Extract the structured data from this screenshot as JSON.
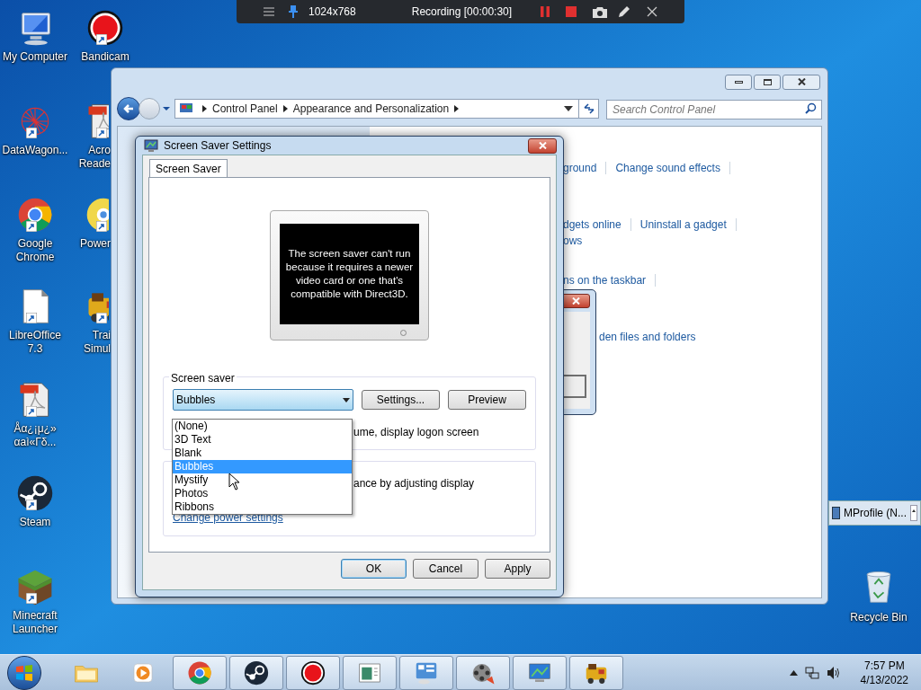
{
  "recorder_bar": {
    "resolution": "1024x768",
    "status": "Recording [00:00:30]"
  },
  "desktop_icons": [
    {
      "kind": "computer",
      "label_lines": [
        "My Computer"
      ]
    },
    {
      "kind": "recorder",
      "label_lines": [
        "Bandicam"
      ]
    },
    {
      "kind": "network",
      "label_lines": [
        "DataWagon..."
      ]
    },
    {
      "kind": "acrobat",
      "label_lines": [
        "Acro",
        "Reade"
      ]
    },
    {
      "kind": "chrome",
      "label_lines": [
        "Google",
        "Chrome"
      ]
    },
    {
      "kind": "disc",
      "label_lines": [
        "Power"
      ]
    },
    {
      "kind": "document",
      "label_lines": [
        "LibreOffice",
        "7.3"
      ]
    },
    {
      "kind": "train",
      "label_lines": [
        "Trai",
        "Simul"
      ]
    },
    {
      "kind": "pdf",
      "label_lines": [
        "Åα¿¡μ¿»",
        "αaì«Γδ..."
      ]
    },
    {
      "kind": "steam",
      "label_lines": [
        "Steam"
      ]
    },
    {
      "kind": "block",
      "label_lines": [
        "Minecraft",
        "Launcher"
      ]
    }
  ],
  "recycle_bin": {
    "label": "Recycle Bin"
  },
  "control_panel": {
    "breadcrumb": [
      "Control Panel",
      "Appearance and Personalization"
    ],
    "search": {
      "placeholder": "Search Control Panel"
    },
    "link_rows": [
      [
        "ground",
        "Change sound effects"
      ],
      [
        "dgets online",
        "Uninstall a gadget"
      ],
      [
        "ows"
      ],
      [
        "ns on the taskbar"
      ],
      [
        "den files and folders"
      ]
    ]
  },
  "dialog": {
    "title": "Screen Saver Settings",
    "tabs": [
      {
        "label": "Screen Saver",
        "selected": true
      }
    ],
    "preview_message": "The screen saver can't run because it requires a newer video card or one that's compatible with Direct3D.",
    "group_label": "Screen saver",
    "dropdown": {
      "value": "Bubbles",
      "expanded": true,
      "options": [
        {
          "label": "(None)",
          "selected": false
        },
        {
          "label": "3D Text",
          "selected": false
        },
        {
          "label": "Blank",
          "selected": false
        },
        {
          "label": "Bubbles",
          "selected": true
        },
        {
          "label": "Mystify",
          "selected": false
        },
        {
          "label": "Photos",
          "selected": false
        },
        {
          "label": "Ribbons",
          "selected": false
        }
      ]
    },
    "group_buttons": [
      "Settings...",
      "Preview"
    ],
    "logon_text": "ume, display logon screen",
    "power_text": "ance by adjusting display",
    "power_link": "Change power settings",
    "footer_buttons": [
      {
        "label": "OK",
        "default": true
      },
      {
        "label": "Cancel",
        "default": false
      },
      {
        "label": "Apply",
        "default": false
      }
    ]
  },
  "mprofile_window": {
    "title": "MProfile (N..."
  },
  "taskbar": {
    "items": [
      {
        "kind": "folder",
        "running": false
      },
      {
        "kind": "media",
        "running": false
      },
      {
        "kind": "chrome",
        "running": true
      },
      {
        "kind": "steam",
        "running": true
      },
      {
        "kind": "recorder",
        "running": true
      },
      {
        "kind": "window",
        "running": true
      },
      {
        "kind": "control-panel",
        "running": true
      },
      {
        "kind": "film",
        "running": true
      },
      {
        "kind": "display",
        "running": true
      },
      {
        "kind": "train",
        "running": true
      }
    ],
    "clock": {
      "time": "7:57 PM",
      "date": "4/13/2022"
    }
  }
}
